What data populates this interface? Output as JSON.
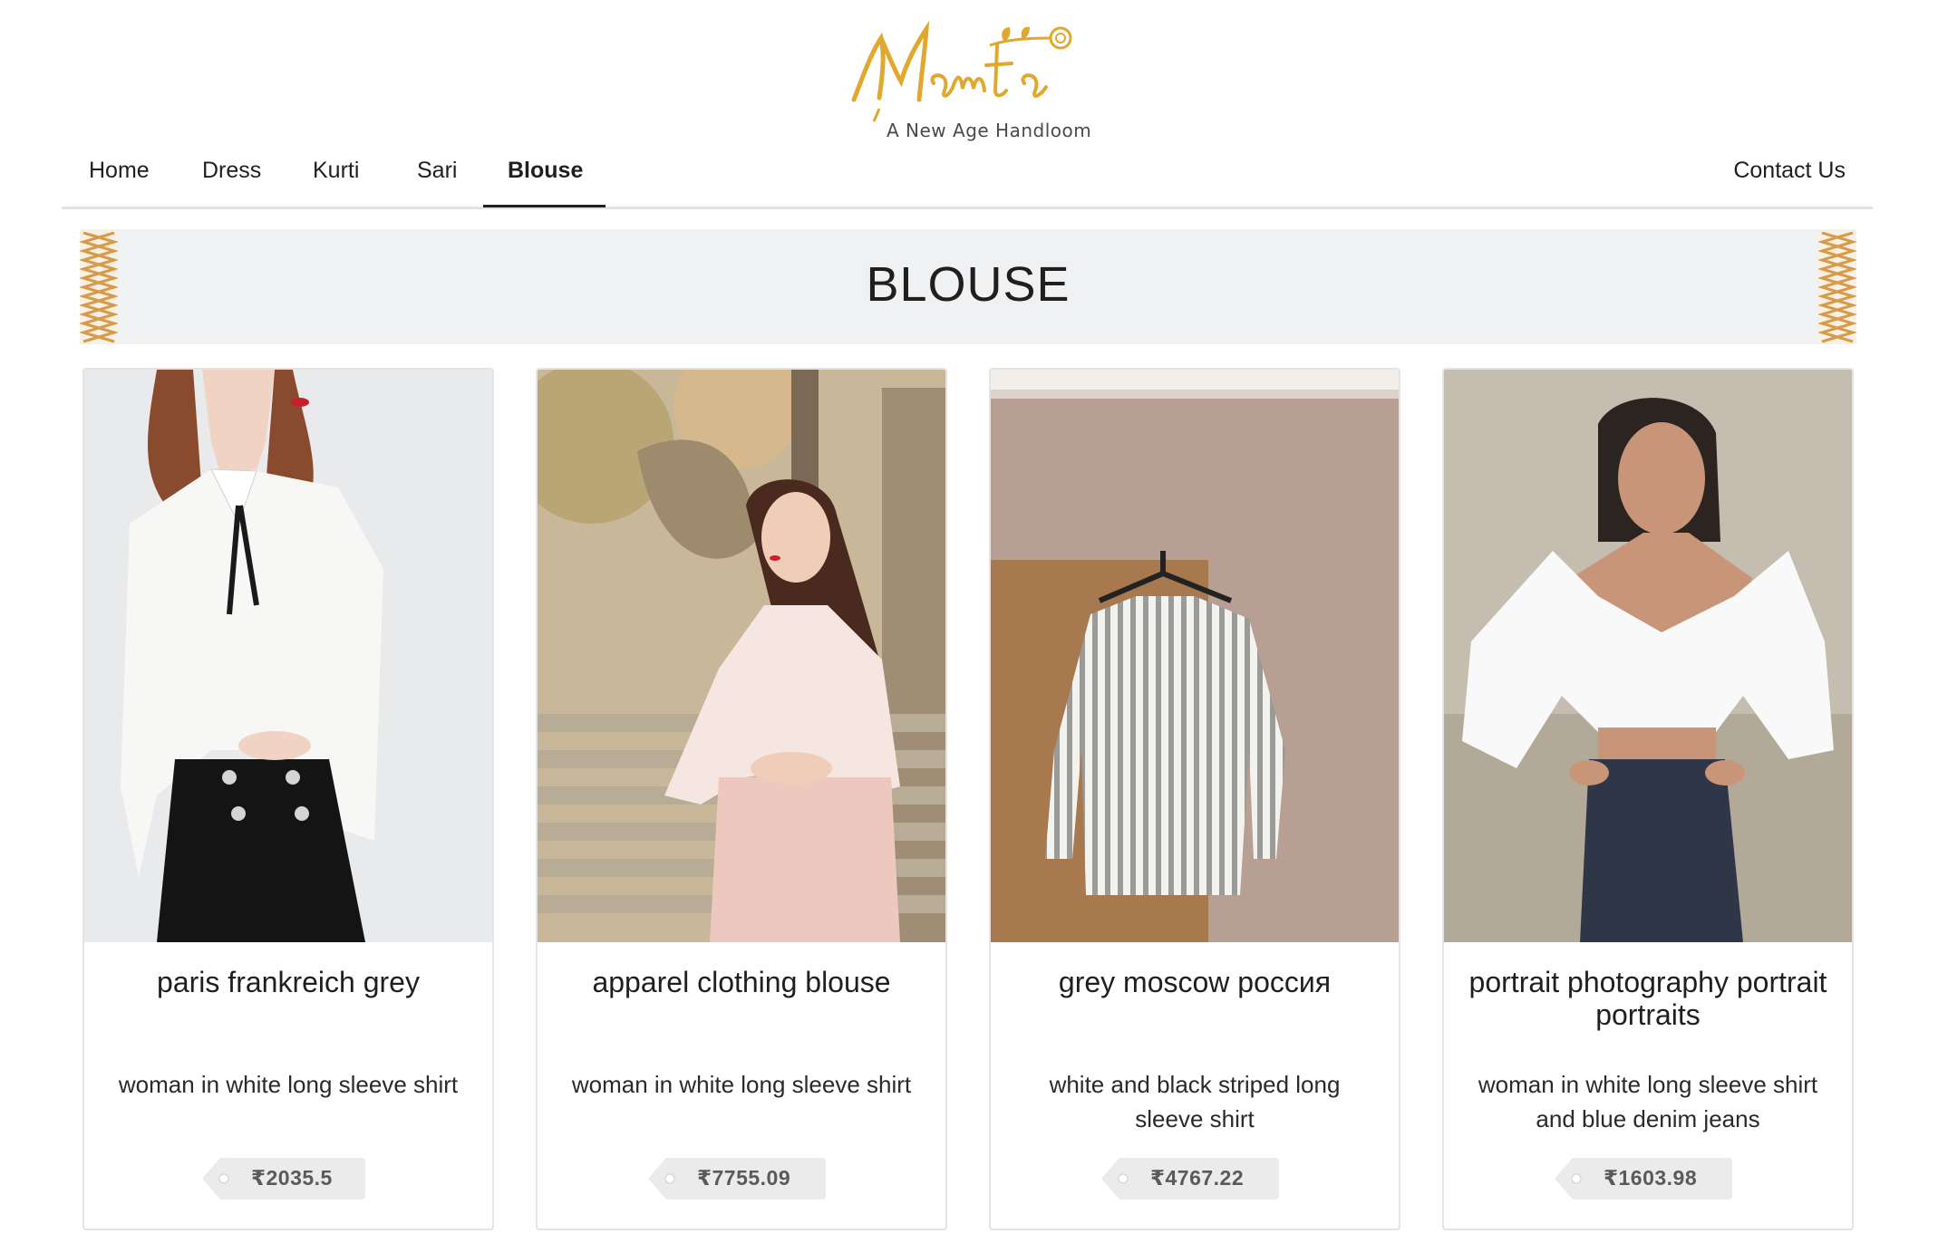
{
  "brand": {
    "logo_text": "Mamta",
    "tagline": "A New Age Handloom",
    "accent_color": "#E0A82E"
  },
  "nav": {
    "items": [
      "Home",
      "Dress",
      "Kurti",
      "Sari",
      "Blouse"
    ],
    "active": "Blouse",
    "contact_label": "Contact Us"
  },
  "page": {
    "title": "BLOUSE"
  },
  "products": [
    {
      "title": "paris frankreich grey",
      "description": "woman in white long sleeve shirt",
      "price": "₹2035.5",
      "image": "woman-white-blouse-black-skirt-photo"
    },
    {
      "title": "apparel clothing blouse",
      "description": "woman in white long sleeve shirt",
      "price": "₹7755.09",
      "image": "woman-pink-blouse-on-stairs-photo"
    },
    {
      "title": "grey moscow россия",
      "description": "white and black striped long sleeve shirt",
      "price": "₹4767.22",
      "image": "striped-shirt-on-hanger-photo"
    },
    {
      "title": "portrait photography portrait portraits",
      "description": "woman in white long sleeve shirt and blue denim jeans",
      "price": "₹1603.98",
      "image": "woman-white-shirt-denim-jeans-photo"
    }
  ]
}
